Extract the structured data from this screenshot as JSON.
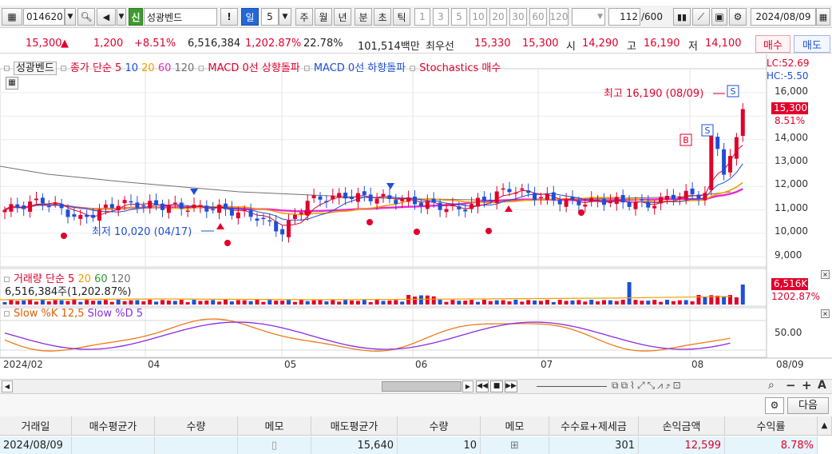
{
  "toolbar": {
    "code": "014620",
    "sector_badge": "신",
    "name": "성광벤드",
    "period_day": "일",
    "period_count": "5",
    "periods": [
      "주",
      "월",
      "년",
      "분",
      "초",
      "틱"
    ],
    "minute_options": [
      "1",
      "3",
      "5",
      "10",
      "20",
      "30",
      "60",
      "120"
    ],
    "view_count": "112",
    "view_total": "/600",
    "date": "2024/08/09"
  },
  "quote": {
    "price": "15,300",
    "arrow": "▲",
    "change": "1,200",
    "change_pct": "+8.51%",
    "volume": "6,516,384",
    "volume_ratio": "1,202.87%",
    "turnover": "22.78%",
    "amount": "101,514백만",
    "best_ask_label": "최우선",
    "best_ask": "15,330",
    "best_bid": "15,300",
    "open_label": "시",
    "open": "14,290",
    "high_label": "고",
    "high": "16,190",
    "low_label": "저",
    "low": "14,100",
    "buy_label": "매수",
    "sell_label": "매도"
  },
  "legend": {
    "name": "성광벤드",
    "ma_label": "종가 단순",
    "ma5": "5",
    "ma10": "10",
    "ma20": "20",
    "ma60": "60",
    "ma120": "120",
    "macd_up": "MACD 0선 상향돌파",
    "macd_down": "MACD 0선 하향돌파",
    "stoch_buy": "Stochastics 매수",
    "lc": "LC:52.69",
    "hc": "HC:-5.50"
  },
  "annotations": {
    "high": "최고 16,190 (08/09)",
    "low": "최저 10,020 (04/17)",
    "signal_s": "S",
    "signal_b": "B"
  },
  "price_axis": {
    "labels": [
      "16,000",
      "15,000",
      "14,000",
      "13,000",
      "12,000",
      "11,000",
      "10,000",
      "9,000"
    ],
    "current": "15,300",
    "current_pct": "8.51%"
  },
  "volume_panel": {
    "title": "거래량",
    "ma_label": "단순",
    "ma5": "5",
    "ma20": "20",
    "ma60": "60",
    "ma120": "120",
    "value_text": "6,516,384주(1,202.87%)",
    "badge": "6,516K",
    "badge_pct": "1202.87%"
  },
  "stoch_panel": {
    "title_k": "Slow %K 12,5",
    "title_d": "Slow %D 5",
    "axis": "50.00"
  },
  "x_axis": {
    "labels": [
      "2024/02",
      "04",
      "05",
      "06",
      "07",
      "08",
      "08/09"
    ]
  },
  "panel": {
    "next_label": "다음"
  },
  "table": {
    "headers": [
      "거래일",
      "매수평균가",
      "수량",
      "메모",
      "매도평균가",
      "수량",
      "메모",
      "수수료+제세금",
      "손익금액",
      "수익률"
    ],
    "row": {
      "date": "2024/08/09",
      "buy_avg": "",
      "buy_qty": "",
      "buy_memo": "",
      "sell_avg": "15,640",
      "sell_qty": "10",
      "sell_memo": "",
      "fee": "301",
      "pnl": "12,599",
      "ret": "8.78%"
    }
  },
  "colors": {
    "up": "#e0002b",
    "down": "#1f4fd8",
    "ma5": "#e0002b",
    "ma20": "#f0a000",
    "ma60": "#e62ad0",
    "ma120": "#707070"
  }
}
